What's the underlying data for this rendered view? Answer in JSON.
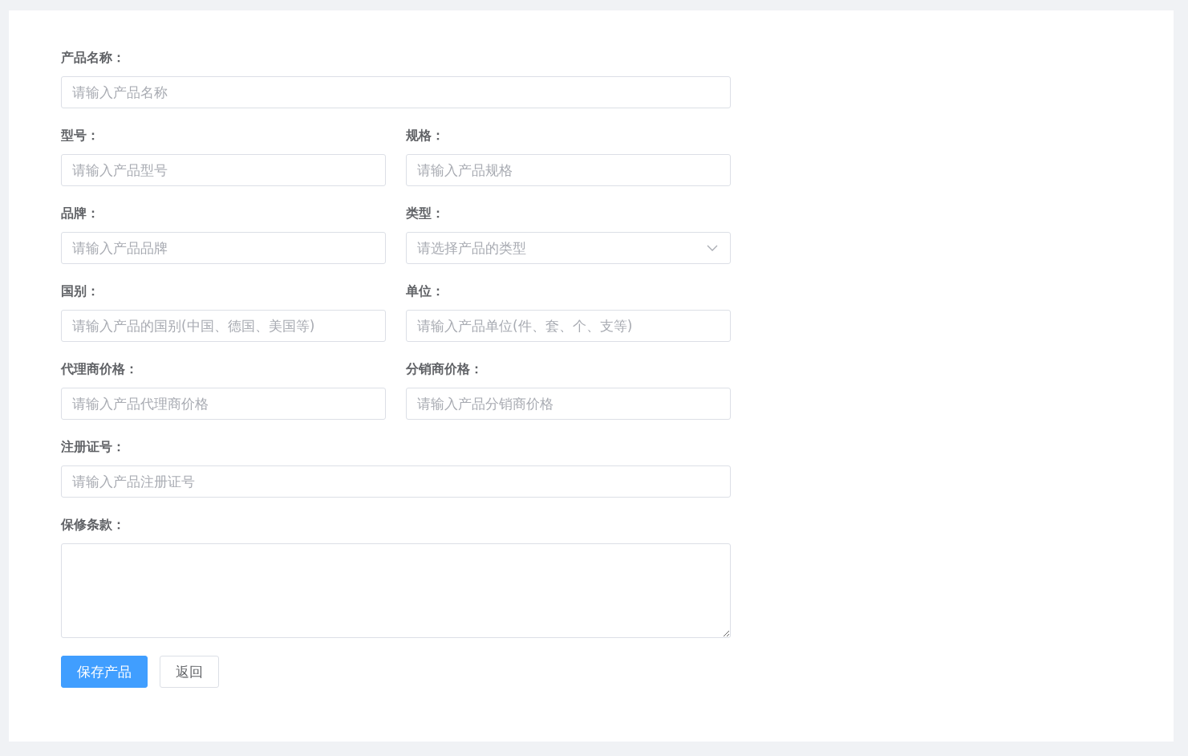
{
  "form": {
    "rows": [
      [
        {
          "label": "产品名称：",
          "placeholder": "请输入产品名称",
          "kind": "input"
        }
      ],
      [
        {
          "label": "型号：",
          "placeholder": "请输入产品型号",
          "kind": "input"
        },
        {
          "label": "规格：",
          "placeholder": "请输入产品规格",
          "kind": "input"
        }
      ],
      [
        {
          "label": "品牌：",
          "placeholder": "请输入产品品牌",
          "kind": "input"
        },
        {
          "label": "类型：",
          "placeholder": "请选择产品的类型",
          "kind": "select"
        }
      ],
      [
        {
          "label": "国别：",
          "placeholder": "请输入产品的国别(中国、德国、美国等)",
          "kind": "input"
        },
        {
          "label": "单位：",
          "placeholder": "请输入产品单位(件、套、个、支等)",
          "kind": "input"
        }
      ],
      [
        {
          "label": "代理商价格：",
          "placeholder": "请输入产品代理商价格",
          "kind": "input"
        },
        {
          "label": "分销商价格：",
          "placeholder": "请输入产品分销商价格",
          "kind": "input"
        }
      ],
      [
        {
          "label": "注册证号：",
          "placeholder": "请输入产品注册证号",
          "kind": "input"
        }
      ],
      [
        {
          "label": "保修条款：",
          "kind": "textarea"
        }
      ]
    ],
    "buttons": [
      {
        "label": "保存产品",
        "kind": "primary"
      },
      {
        "label": "返回",
        "kind": "default"
      }
    ]
  }
}
